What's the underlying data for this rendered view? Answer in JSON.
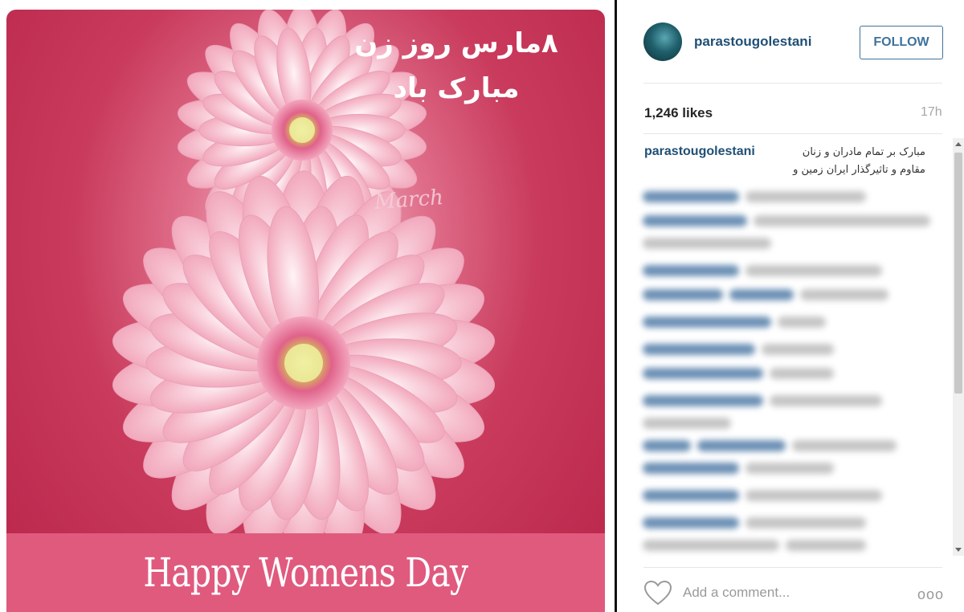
{
  "image": {
    "arabic_title_line1": "۸مارس روز زن",
    "arabic_title_line2": "مبارک باد",
    "script_text": "March",
    "banner_text": "Happy Womens Day"
  },
  "post": {
    "username": "parastougolestani",
    "follow_label": "FOLLOW",
    "likes": "1,246 likes",
    "time_ago": "17h",
    "caption_line1": "مبارک بر تمام مادران و زنان",
    "caption_line2": "مقاوم و تاثیرگذار ایران زمین و",
    "comment_placeholder": "Add a comment...",
    "more_label": "ooo"
  },
  "colors": {
    "image_bg": "#c93a5c",
    "banner_bg": "#e05a7e",
    "username": "#1f4f75",
    "follow_border": "#3f729b"
  },
  "icons": [
    "heart-icon",
    "more-options-icon"
  ]
}
